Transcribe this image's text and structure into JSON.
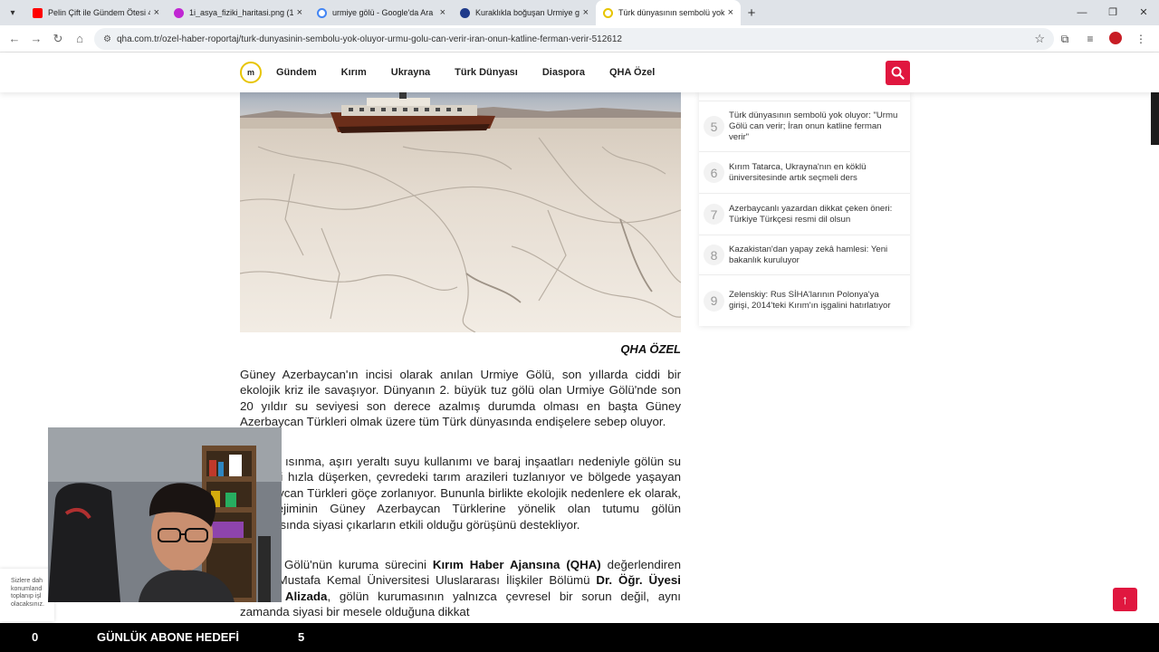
{
  "browser": {
    "tabs": [
      {
        "title": "Pelin Çift ile Gündem Ötesi 473.",
        "icon_color": "#ff0000"
      },
      {
        "title": "1i_asya_fiziki_haritasi.png (162",
        "icon_color": "#c026d3"
      },
      {
        "title": "urmiye gölü - Google'da Ara",
        "icon_color": "#4285f4"
      },
      {
        "title": "Kuraklıkla boğuşan Urmiye gölü",
        "icon_color": "#1e3a8a"
      },
      {
        "title": "Türk dünyasının sembolü yok o",
        "icon_color": "#e7c400"
      }
    ],
    "address": "qha.com.tr/ozel-haber-roportaj/turk-dunyasinin-sembolu-yok-oluyor-urmu-golu-can-verir-iran-onun-katline-ferman-verir-512612"
  },
  "site": {
    "logo_text": "m",
    "nav": [
      "Gündem",
      "Kırım",
      "Ukrayna",
      "Türk Dünyası",
      "Diaspora",
      "QHA Özel"
    ]
  },
  "article": {
    "byline": "QHA ÖZEL",
    "p1": "Güney Azerbaycan'ın incisi olarak anılan Urmiye Gölü, son yıllarda ciddi bir ekolojik kriz ile savaşıyor. Dünyanın 2. büyük tuz gölü olan Urmiye Gölü'nde son 20 yıldır su seviyesi son derece azalmış durumda olması en başta Güney Azerbaycan Türkleri olmak üzere tüm Türk dünyasında endişelere sebep oluyor.",
    "p2": "Küresel ısınma, aşırı yeraltı suyu kullanımı ve baraj inşaatları nedeniyle gölün su seviyesi hızla düşerken, çevredeki tarım arazileri tuzlanıyor ve bölgede yaşayan Azerbaycan Türkleri göçe zorlanıyor. Bununla birlikte ekolojik nedenlere ek olarak, İran rejiminin Güney Azerbaycan Türklerine yönelik olan tutumu gölün kurumasında siyasi çıkarların etkili olduğu görüşünü destekliyor.",
    "p3_a": "Urmiye Gölü'nün kuruma sürecini ",
    "p3_b": "Kırım Haber Ajansına (QHA)",
    "p3_c": " değerlendiren Hatay Mustafa Kemal Üniversitesi Uluslararası İlişkiler Bölümü ",
    "p3_d": "Dr. Öğr. Üyesi Nazrin Alizada",
    "p3_e": ", gölün kurumasının yalnızca çevresel bir sorun değil, aynı zamanda siyasi bir mesele olduğuna dikkat"
  },
  "sidebar": {
    "items": [
      {
        "num": "5",
        "text": "Türk dünyasının sembolü yok oluyor: \"Urmu Gölü can verir; İran onun katline ferman verir\""
      },
      {
        "num": "6",
        "text": "Kırım Tatarca, Ukrayna'nın en köklü üniversitesinde artık seçmeli ders"
      },
      {
        "num": "7",
        "text": "Azerbaycanlı yazardan dikkat çeken öneri: Türkiye Türkçesi resmi dil olsun"
      },
      {
        "num": "8",
        "text": "Kazakistan'dan yapay zekâ hamlesi: Yeni bakanlık kuruluyor"
      },
      {
        "num": "9",
        "text": "Zelenskiy: Rus SİHA'larının Polonya'ya girişi, 2014'teki Kırım'ın işgalini hatırlatıyor"
      }
    ]
  },
  "cookie": {
    "text": "Sizlere dah konumland toplanıp işl olacaksınız."
  },
  "stream": {
    "count_left": "0",
    "label": "GÜNLÜK ABONE HEDEFİ",
    "count_right": "5"
  },
  "colors": {
    "accent": "#e0173f",
    "logo_ring": "#e7c400"
  }
}
